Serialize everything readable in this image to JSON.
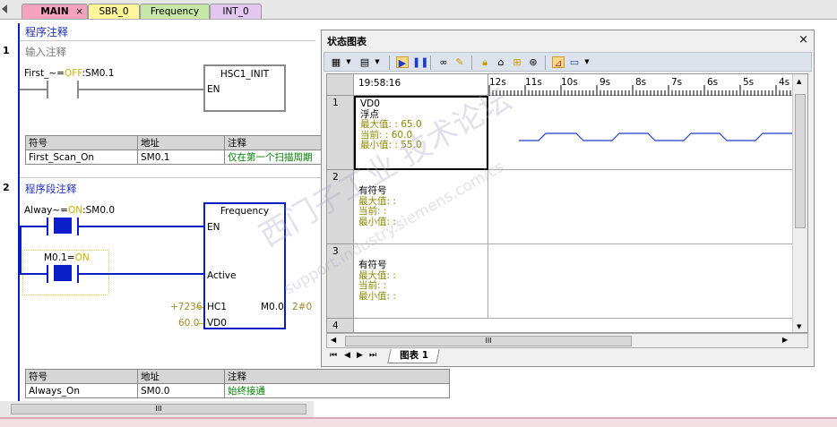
{
  "tabs": [
    {
      "label": "MAIN",
      "close": "×"
    },
    {
      "label": "SBR_0"
    },
    {
      "label": "Frequency"
    },
    {
      "label": "INT_0"
    }
  ],
  "program_comment": "程序注释",
  "network1": {
    "number": "1",
    "comment": "输入注释",
    "contact_label_prefix": "First_~=",
    "contact_state": "OFF",
    "contact_addr": ":SM0.1",
    "box_title": "HSC1_INIT",
    "box_en": "EN",
    "symbols": {
      "headers": [
        "符号",
        "地址",
        "注释"
      ],
      "rows": [
        [
          "First_Scan_On",
          "SM0.1",
          "仅在第一个扫描周期"
        ]
      ]
    }
  },
  "network2": {
    "number": "2",
    "comment": "程序段注释",
    "contact1_prefix": "Alway~=",
    "contact1_state": "ON",
    "contact1_addr": ":SM0.0",
    "contact2_prefix": "M0.1=",
    "contact2_state": "ON",
    "box_title": "Frequency",
    "box_en": "EN",
    "box_active": "Active",
    "box_hc1": "HC1",
    "box_vd0": "VD0",
    "box_m00": "M0.0",
    "in_hc1": "+7236",
    "in_vd0": "60.0",
    "out_m00": "2#0",
    "symbols": {
      "headers": [
        "符号",
        "地址",
        "注释"
      ],
      "rows": [
        [
          "Always_On",
          "SM0.0",
          "始终接通"
        ]
      ]
    }
  },
  "status_chart": {
    "title": "状态图表",
    "close": "×",
    "time": "19:58:16",
    "ticks": [
      "12s",
      "11s",
      "10s",
      "9s",
      "8s",
      "7s",
      "6s",
      "5s",
      "4s"
    ],
    "rows": [
      {
        "num": "1",
        "name": "VD0",
        "format": "浮点",
        "max": "最大值: : 65.0",
        "cur": "当前: : 60.0",
        "min": "最小值: : 55.0"
      },
      {
        "num": "2",
        "name": "",
        "format": "有符号",
        "max": "最大值: :",
        "cur": "当前: :",
        "min": "最小值: :"
      },
      {
        "num": "3",
        "name": "",
        "format": "有符号",
        "max": "最大值: :",
        "cur": "当前: :",
        "min": "最小值: :"
      },
      {
        "num": "4"
      }
    ],
    "sheet_tab": "图表  1",
    "trace_color": "#1a3ec8"
  },
  "watermark": "西门子工业  技术论坛",
  "watermark_url": "support.industry.siemens.com/cs",
  "scroll_grip": "III"
}
